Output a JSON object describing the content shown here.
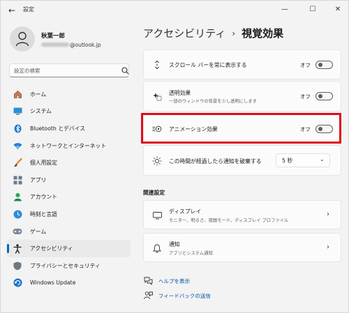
{
  "window": {
    "title": "設定",
    "minimize": "—",
    "maximize": "☐",
    "close": "✕",
    "back": "←"
  },
  "user": {
    "name": "秋葉一郎",
    "email_visible": "@outlook.jp"
  },
  "search": {
    "placeholder": "設定の検索"
  },
  "sidebar": {
    "items": [
      {
        "label": "ホーム",
        "icon": "home-icon"
      },
      {
        "label": "システム",
        "icon": "system-icon"
      },
      {
        "label": "Bluetooth とデバイス",
        "icon": "bluetooth-icon"
      },
      {
        "label": "ネットワークとインターネット",
        "icon": "wifi-icon"
      },
      {
        "label": "個人用設定",
        "icon": "brush-icon"
      },
      {
        "label": "アプリ",
        "icon": "apps-icon"
      },
      {
        "label": "アカウント",
        "icon": "account-icon"
      },
      {
        "label": "時刻と言語",
        "icon": "time-language-icon"
      },
      {
        "label": "ゲーム",
        "icon": "game-icon"
      },
      {
        "label": "アクセシビリティ",
        "icon": "accessibility-icon",
        "active": true
      },
      {
        "label": "プライバシーとセキュリティ",
        "icon": "shield-icon"
      },
      {
        "label": "Windows Update",
        "icon": "update-icon"
      }
    ]
  },
  "main": {
    "breadcrumb_parent": "アクセシビリティ",
    "breadcrumb_sep": "›",
    "page_title": "視覚効果",
    "settings": {
      "scrollbar": {
        "title": "スクロール バーを常に表示する",
        "state": "オフ",
        "on": false
      },
      "transparency": {
        "title": "透明効果",
        "subtitle": "一部のウィンドウの背景を少し透明にします",
        "state": "オフ",
        "on": false
      },
      "animation": {
        "title": "アニメーション効果",
        "state": "オフ",
        "on": false
      },
      "notification": {
        "title": "この時間が経過したら通知を破棄する",
        "value": "5 秒"
      }
    },
    "related_title": "関連設定",
    "related": {
      "display": {
        "title": "ディスプレイ",
        "subtitle": "モニター、明るさ、夜間モード、ディスプレイ プロファイル"
      },
      "notifications": {
        "title": "通知",
        "subtitle": "アプリとシステム通知"
      }
    },
    "links": {
      "help": "ヘルプを表示",
      "feedback": "フィードバックの送信"
    }
  },
  "colors": {
    "accent": "#0067c0",
    "highlight": "#e0091b"
  }
}
